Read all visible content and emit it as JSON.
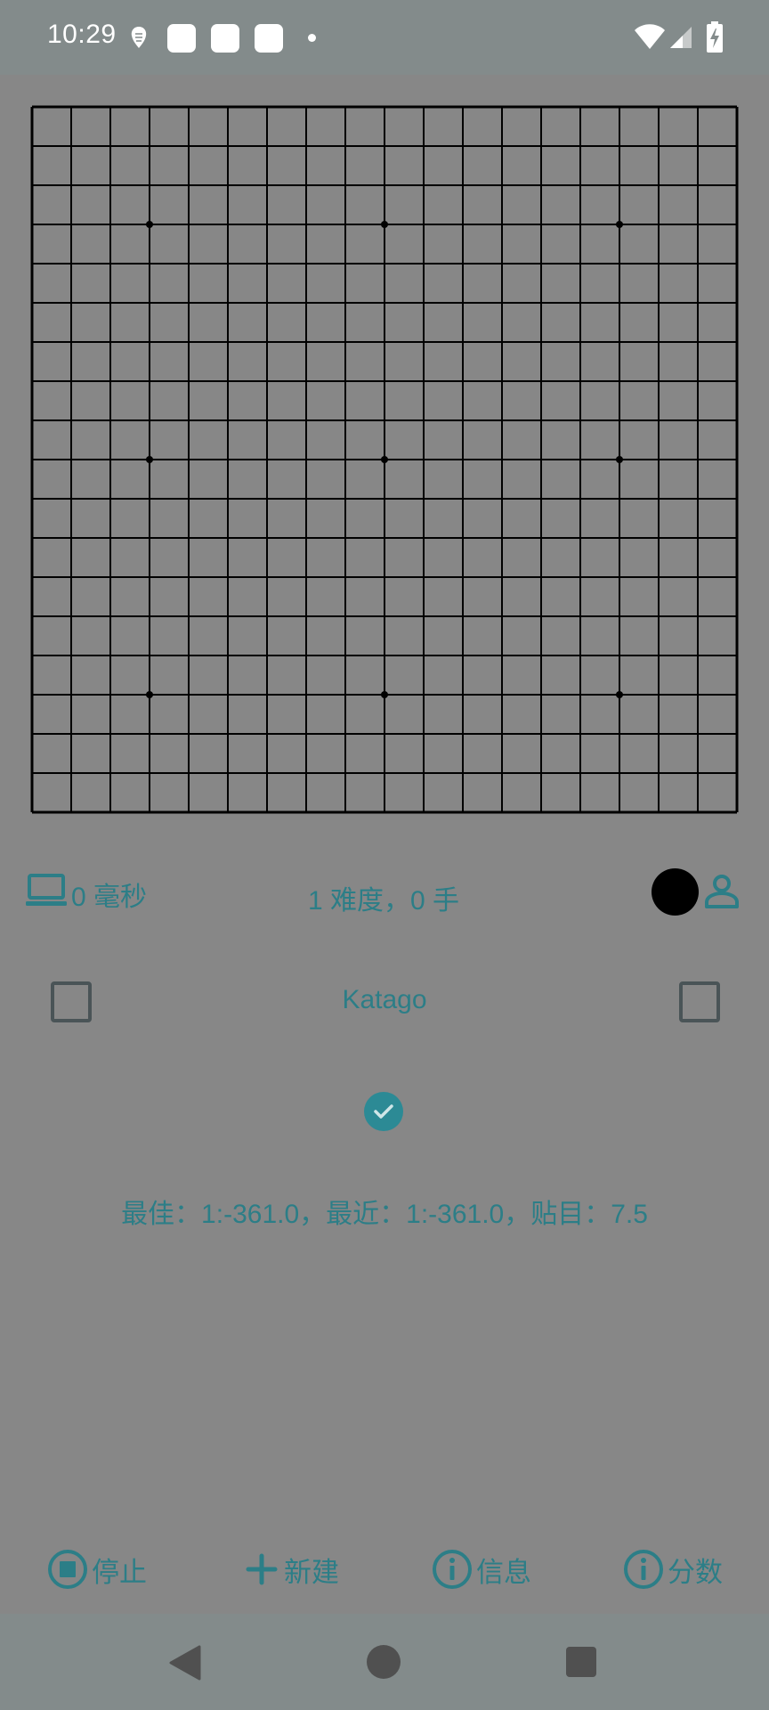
{
  "status_bar": {
    "time": "10:29"
  },
  "board": {
    "size": 19,
    "star_points": [
      [
        3,
        3
      ],
      [
        3,
        9
      ],
      [
        3,
        15
      ],
      [
        9,
        3
      ],
      [
        9,
        9
      ],
      [
        9,
        15
      ],
      [
        15,
        3
      ],
      [
        15,
        9
      ],
      [
        15,
        15
      ]
    ]
  },
  "info": {
    "time_text": "0 毫秒",
    "level_text": "1 难度，0 手",
    "turn_color": "#000000"
  },
  "engine": {
    "name": "Katago"
  },
  "score_line": "最佳：1:-361.0，最近：1:-361.0，贴目：7.5",
  "actions": {
    "stop": "停止",
    "new": "新建",
    "info": "信息",
    "score": "分数"
  },
  "colors": {
    "accent": "#2c7e87",
    "background": "#878787",
    "status_bar": "#838b8b"
  }
}
